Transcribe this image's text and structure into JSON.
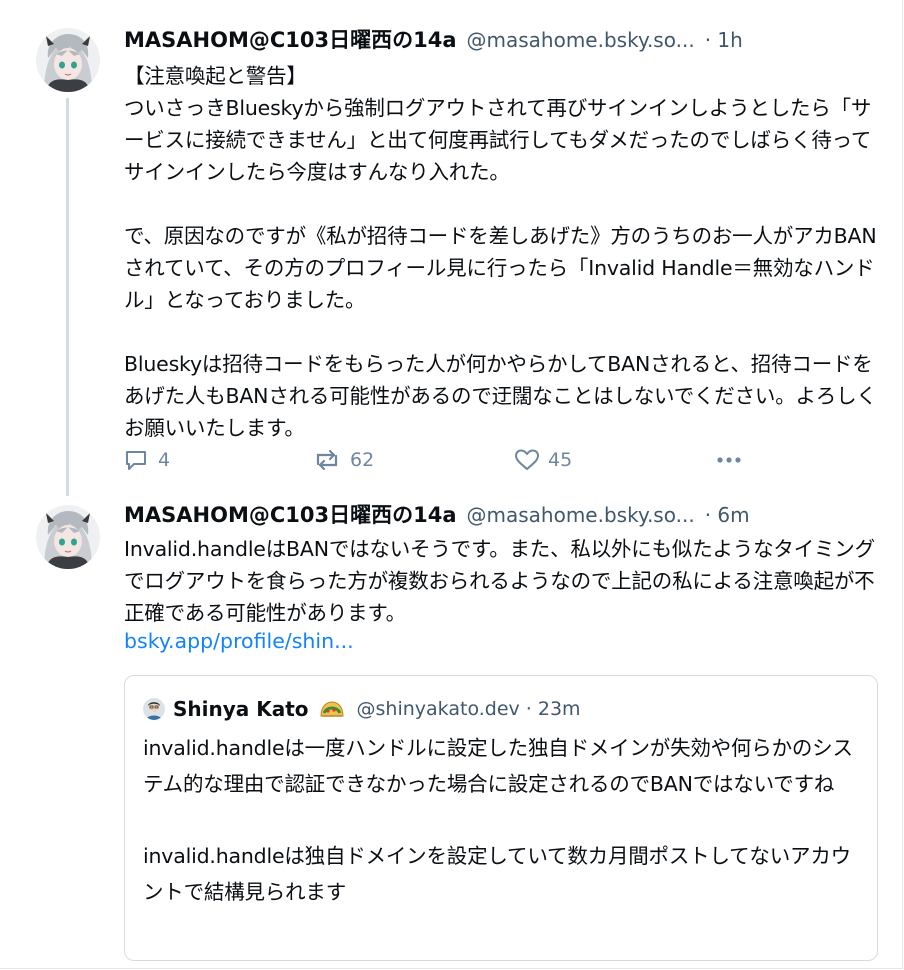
{
  "posts": [
    {
      "author": {
        "display_name": "MASAHOM@C103日曜西の14a",
        "handle": "@masahome.bsky.so...",
        "avatar_icon": "anime-avatar-icon"
      },
      "time": "· 1h",
      "text": "【注意喚起と警告】\nついさっきBlueskyから強制ログアウトされて再びサインインしようとしたら「サービスに接続できません」と出て何度再試行してもダメだったのでしばらく待ってサインインしたら今度はすんなり入れた。\n\nで、原因なのですが《私が招待コードを差しあげた》方のうちのお一人がアカBANされていて、その方のプロフィール見に行ったら「Invalid Handle＝無効なハンドル」となっておりました。\n\nBlueskyは招待コードをもらった人が何かやらかしてBANされると、招待コードをあげた人もBANされる可能性があるので迂闊なことはしないでください。よろしくお願いいたします。",
      "actions": {
        "reply_count": "4",
        "repost_count": "62",
        "like_count": "45"
      }
    },
    {
      "author": {
        "display_name": "MASAHOM@C103日曜西の14a",
        "handle": "@masahome.bsky.so...",
        "avatar_icon": "anime-avatar-icon"
      },
      "time": "· 6m",
      "text": "Invalid.handleはBANではないそうです。また、私以外にも似たようなタイミングでログアウトを食らった方が複数おられるようなので上記の私による注意喚起が不正確である可能性があります。",
      "link": "bsky.app/profile/shin...",
      "quote": {
        "display_name": "Shinya Kato",
        "badge_icon": "taco-emoji-icon",
        "handle": "@shinyakato.dev",
        "time": "· 23m",
        "text": "invalid.handleは一度ハンドルに設定した独自ドメインが失効や何らかのシステム的な理由で認証できなかった場合に設定されるのでBANではないですね\n\ninvalid.handleは独自ドメインを設定していて数カ月間ポストしてないアカウントで結構見られます"
      }
    }
  ],
  "colors": {
    "text": "#0b0f14",
    "muted": "#42576c",
    "action": "#6f869f",
    "link": "#1083fe",
    "border": "#d4dbe2"
  }
}
